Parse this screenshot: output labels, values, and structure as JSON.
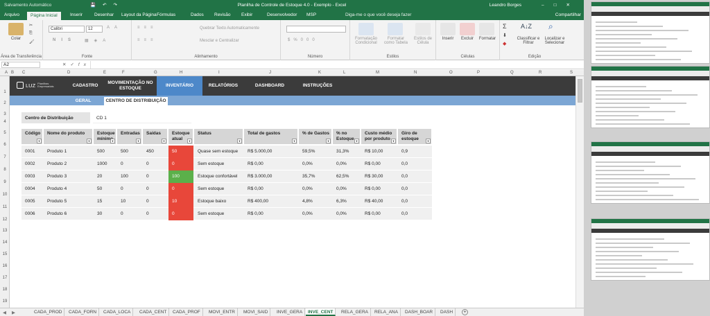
{
  "window": {
    "autosave": "Salvamento Automático",
    "title": "Planilha de Controle de Estoque 4.0 - Exemplo - Excel",
    "user": "Leandro Borges",
    "share": "Compartilhar",
    "tell_me": "Diga-me o que você deseja fazer"
  },
  "ribbon_tabs": [
    "Arquivo",
    "Página Inicial",
    "Inserir",
    "Desenhar",
    "Layout da Página",
    "Fórmulas",
    "Dados",
    "Revisão",
    "Exibir",
    "Desenvolvedor",
    "MSP"
  ],
  "ribbon": {
    "paste": "Colar",
    "font_name": "Calibri",
    "font_size": "12",
    "wrap": "Quebrar Texto Automaticamente",
    "merge": "Mesclar e Centralizar",
    "cond_format": "Formatação Condicional",
    "format_table": "Formatar como Tabela",
    "cell_styles": "Estilos de Célula",
    "insert": "Inserir",
    "delete": "Excluir",
    "format": "Formatar",
    "sort_filter": "Classificar e Filtrar",
    "find_select": "Localizar e Selecionar",
    "groups": [
      "Área de Transferência",
      "Fonte",
      "Alinhamento",
      "Número",
      "Estilos",
      "Células",
      "Edição"
    ]
  },
  "formula_bar": {
    "name_box": "A2",
    "fx": "fx",
    "formula": ""
  },
  "columns": [
    "A",
    "B",
    "C",
    "D",
    "E",
    "F",
    "G",
    "H",
    "I",
    "J",
    "K",
    "L",
    "M",
    "N",
    "O",
    "P",
    "Q",
    "R",
    "S"
  ],
  "rows": [
    "1",
    "2",
    "3",
    "4",
    "5",
    "6",
    "7",
    "8",
    "9",
    "10",
    "11",
    "12",
    "13",
    "14",
    "15",
    "16",
    "17",
    "18",
    "19"
  ],
  "nav": {
    "logo": "LUZ",
    "logo_sub": "Planilhas Empresariais",
    "items": [
      "CADASTRO",
      "MOVIMENTAÇÃO NO ESTOQUE",
      "INVENTÁRIO",
      "RELATÓRIOS",
      "DASHBOARD",
      "INSTRUÇÕES"
    ],
    "active": "INVENTÁRIO"
  },
  "subnav": {
    "items": [
      "GERAL",
      "CENTRO DE DISTRIBUIÇÃO"
    ],
    "active": "CENTRO DE DISTRIBUIÇÃO"
  },
  "filter": {
    "label": "Centro de Distribuição",
    "value": "CD 1"
  },
  "table": {
    "headers": [
      "Código",
      "Nome do produto",
      "Estoque mínimo",
      "Entradas",
      "Saídas",
      "Estoque atual",
      "Status",
      "Total de gastos",
      "% de Gastos",
      "% no Estoque",
      "Custo médio por produto",
      "Giro de estoque"
    ],
    "rows": [
      {
        "codigo": "0001",
        "nome": "Produto 1",
        "minimo": "500",
        "entradas": "500",
        "saidas": "450",
        "atual": "50",
        "status": "Quase sem estoque",
        "total": "R$ 5.000,00",
        "pct_gastos": "59,5%",
        "pct_estoque": "31,3%",
        "custo": "R$ 10,00",
        "giro": "0,9",
        "color": "#e8473a"
      },
      {
        "codigo": "0002",
        "nome": "Produto 2",
        "minimo": "1000",
        "entradas": "0",
        "saidas": "0",
        "atual": "0",
        "status": "Sem estoque",
        "total": "R$ 0,00",
        "pct_gastos": "0,0%",
        "pct_estoque": "0,0%",
        "custo": "R$ 0,00",
        "giro": "0,0",
        "color": "#e8473a"
      },
      {
        "codigo": "0003",
        "nome": "Produto 3",
        "minimo": "20",
        "entradas": "100",
        "saidas": "0",
        "atual": "100",
        "status": "Estoque confortável",
        "total": "R$ 3.000,00",
        "pct_gastos": "35,7%",
        "pct_estoque": "62,5%",
        "custo": "R$ 30,00",
        "giro": "0,0",
        "color": "#5bb04a"
      },
      {
        "codigo": "0004",
        "nome": "Produto 4",
        "minimo": "50",
        "entradas": "0",
        "saidas": "0",
        "atual": "0",
        "status": "Sem estoque",
        "total": "R$ 0,00",
        "pct_gastos": "0,0%",
        "pct_estoque": "0,0%",
        "custo": "R$ 0,00",
        "giro": "0,0",
        "color": "#e8473a"
      },
      {
        "codigo": "0005",
        "nome": "Produto 5",
        "minimo": "15",
        "entradas": "10",
        "saidas": "0",
        "atual": "10",
        "status": "Estoque baixo",
        "total": "R$ 400,00",
        "pct_gastos": "4,8%",
        "pct_estoque": "6,3%",
        "custo": "R$ 40,00",
        "giro": "0,0",
        "color": "#e8473a"
      },
      {
        "codigo": "0006",
        "nome": "Produto 6",
        "minimo": "30",
        "entradas": "0",
        "saidas": "0",
        "atual": "0",
        "status": "Sem estoque",
        "total": "R$ 0,00",
        "pct_gastos": "0,0%",
        "pct_estoque": "0,0%",
        "custo": "R$ 0,00",
        "giro": "0,0",
        "color": "#e8473a"
      }
    ]
  },
  "sheet_tabs": [
    "CADA_PROD",
    "CADA_FORN",
    "CADA_LOCA",
    "CADA_CENT",
    "CADA_PROF",
    "MOVI_ENTR",
    "MOVI_SAID",
    "INVE_GERA",
    "INVE_CENT",
    "RELA_GERA",
    "RELA_ANA",
    "DASH_BOAR",
    "DASH"
  ],
  "active_sheet": "INVE_CENT"
}
